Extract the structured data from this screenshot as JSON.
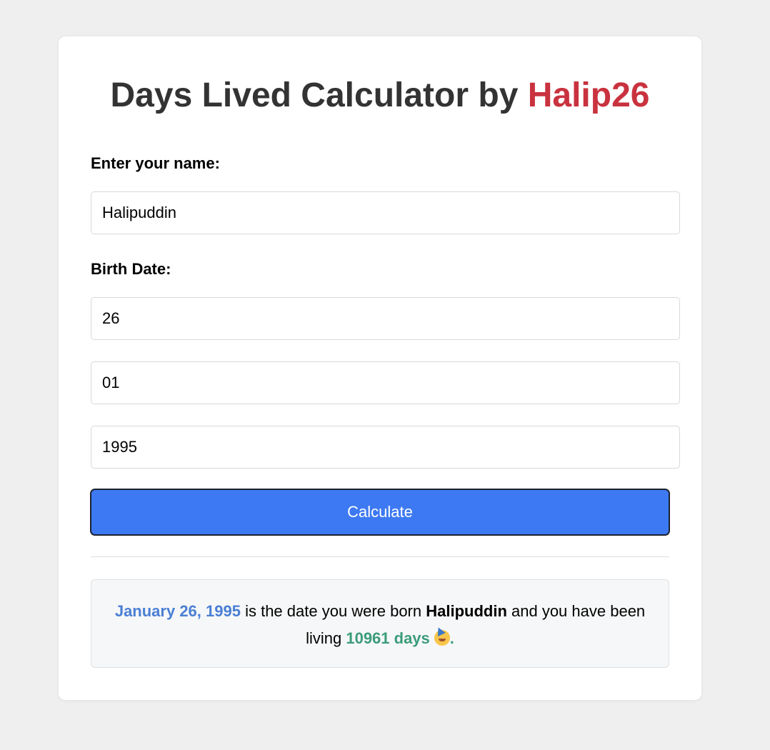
{
  "header": {
    "title_prefix": "Days Lived Calculator by ",
    "title_accent": "Halip26"
  },
  "form": {
    "name_label": "Enter your name:",
    "name_value": "Halipuddin",
    "birth_label": "Birth Date:",
    "day_value": "26",
    "month_value": "01",
    "year_value": "1995",
    "calculate_label": "Calculate"
  },
  "result": {
    "date_text": "January 26, 1995",
    "middle_text": " is the date you were born ",
    "name_text": "Halipuddin",
    "after_name_text": " and you have been living ",
    "days_text": "10961 days",
    "emoji": "partying-face-icon",
    "period": "."
  },
  "colors": {
    "accent_red": "#c9323f",
    "button_blue": "#3d79f2",
    "date_blue": "#4a7fd4",
    "days_green": "#3b9c7a"
  }
}
